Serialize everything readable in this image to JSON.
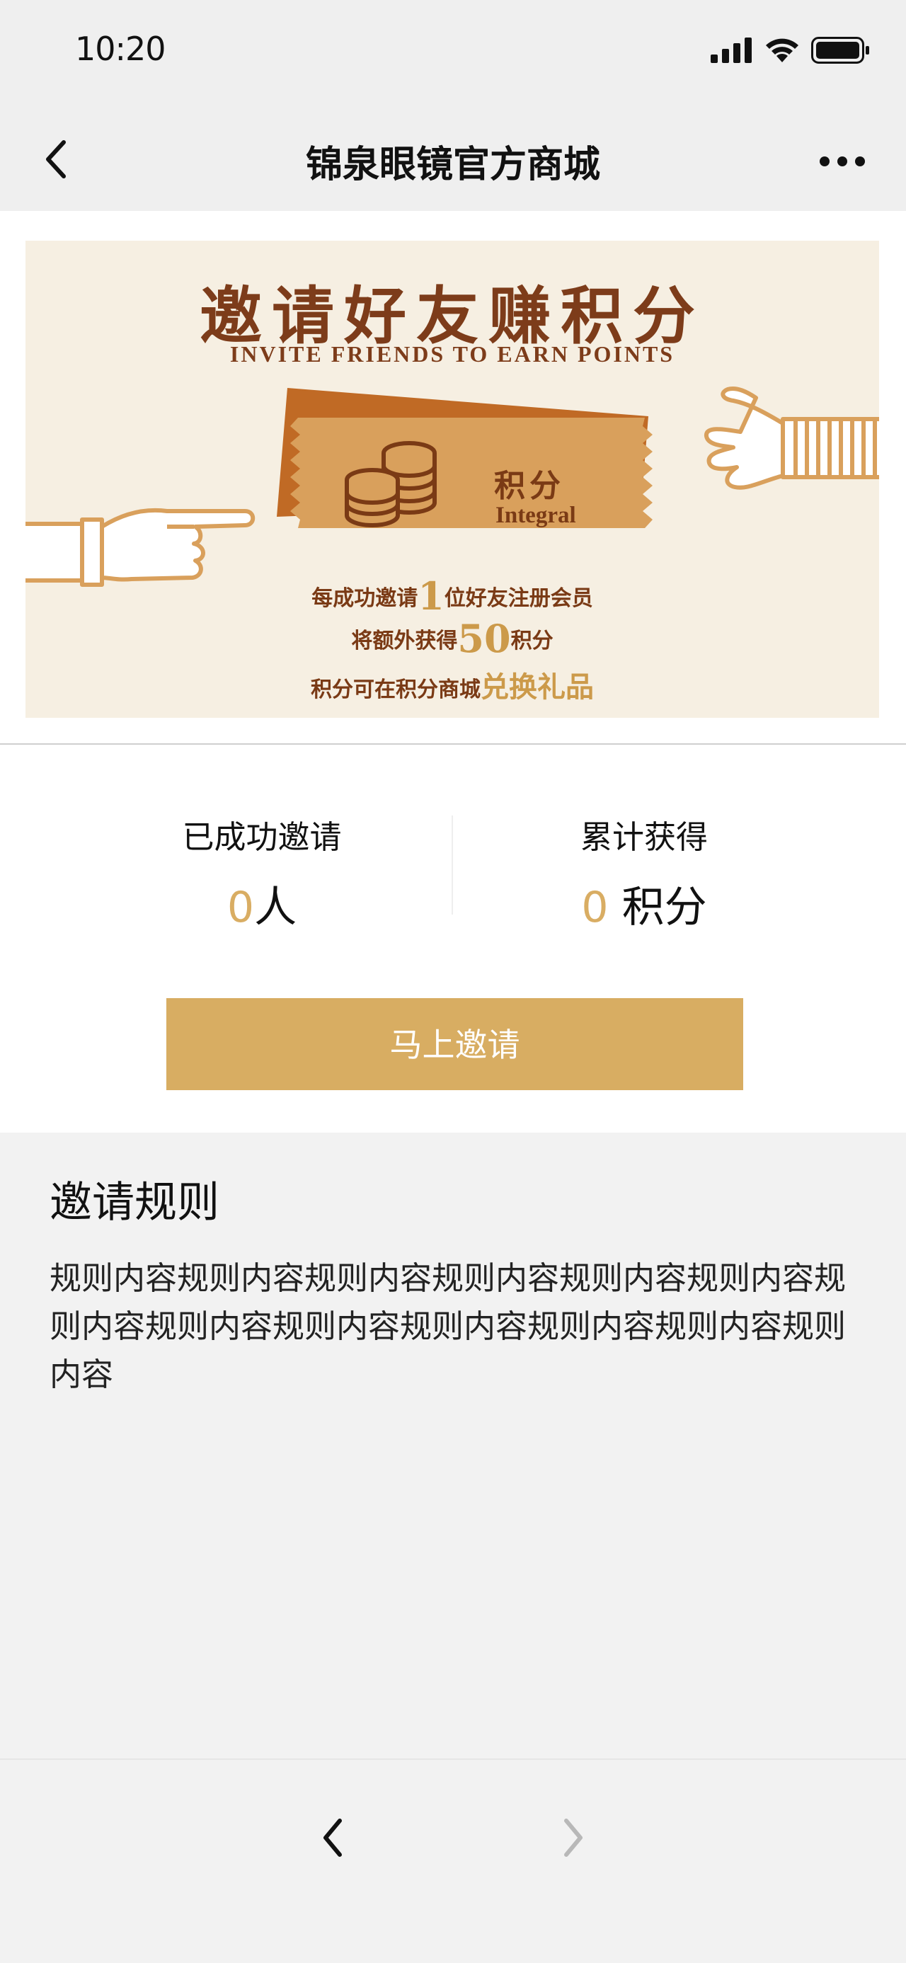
{
  "status_bar": {
    "time": "10:20"
  },
  "nav": {
    "title": "锦泉眼镜官方商城"
  },
  "banner": {
    "title": "邀请好友赚积分",
    "subtitle": "INVITE FRIENDS TO EARN POINTS",
    "ticket_label": "积分",
    "ticket_sub": "Integral",
    "line1_pre": "每成功邀请",
    "line1_num": "1",
    "line1_post": "位好友注册会员",
    "line2_pre": "将额外获得",
    "line2_num": "50",
    "line2_post": "积分",
    "line3_pre": "积分可在积分商城",
    "line3_accent": "兑换礼品"
  },
  "stats": {
    "invited_label": "已成功邀请",
    "invited_value": "0",
    "invited_unit": "人",
    "earned_label": "累计获得",
    "earned_value": "0",
    "earned_unit": " 积分"
  },
  "invite_button": {
    "label": "马上邀请"
  },
  "rules": {
    "title": "邀请规则",
    "body": "规则内容规则内容规则内容规则内容规则内容规则内容规则内容规则内容规则内容规则内容规则内容规则内容规则内容"
  },
  "colors": {
    "accent": "#d8ad62",
    "banner_bg": "#f6efe2",
    "banner_text": "#7d3c1a",
    "page_bg": "#f2f2f2"
  }
}
